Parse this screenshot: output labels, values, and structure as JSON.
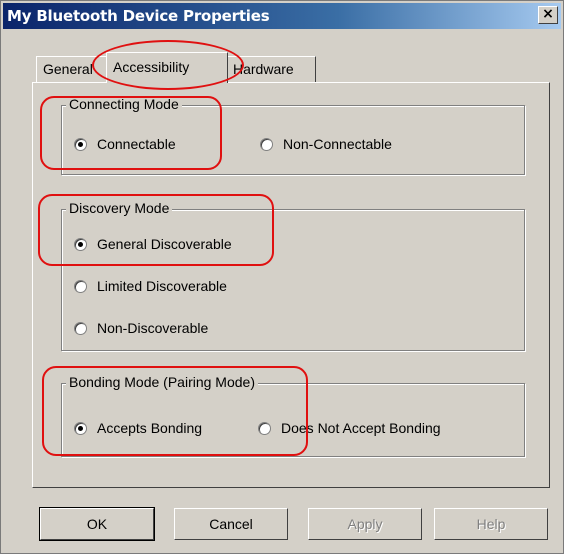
{
  "window": {
    "title": "My Bluetooth Device Properties",
    "close_glyph": "×"
  },
  "tabs": [
    {
      "label": "General"
    },
    {
      "label": "Accessibility",
      "active": true
    },
    {
      "label": "Hardware"
    }
  ],
  "groups": {
    "connecting": {
      "legend": "Connecting Mode",
      "options": [
        {
          "label": "Connectable",
          "checked": true
        },
        {
          "label": "Non-Connectable",
          "checked": false
        }
      ]
    },
    "discovery": {
      "legend": "Discovery Mode",
      "options": [
        {
          "label": "General Discoverable",
          "checked": true
        },
        {
          "label": "Limited Discoverable",
          "checked": false
        },
        {
          "label": "Non-Discoverable",
          "checked": false
        }
      ]
    },
    "bonding": {
      "legend": "Bonding Mode (Pairing Mode)",
      "options": [
        {
          "label": "Accepts Bonding",
          "checked": true
        },
        {
          "label": "Does Not Accept Bonding",
          "checked": false
        }
      ]
    }
  },
  "buttons": {
    "ok": "OK",
    "cancel": "Cancel",
    "apply": "Apply",
    "help": "Help"
  },
  "annotation_color": "#e01010"
}
